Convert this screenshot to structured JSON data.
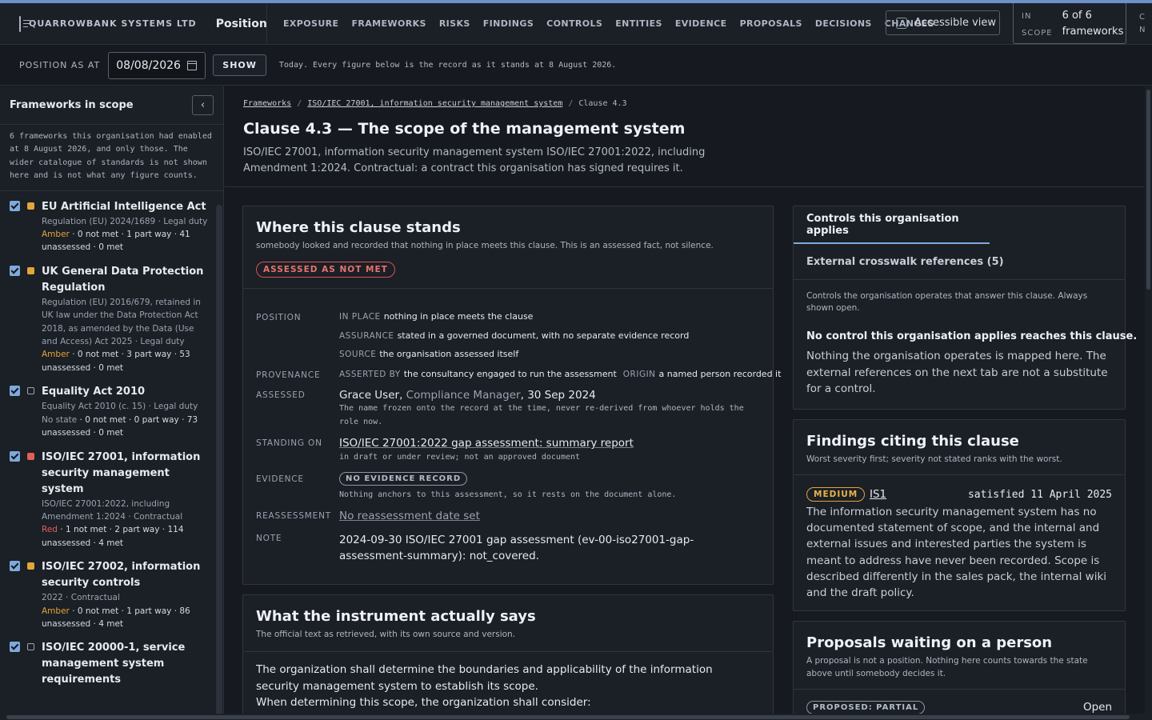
{
  "header": {
    "brand": "QUARROWBANK SYSTEMS LTD",
    "section": "Position",
    "nav": [
      "EXPOSURE",
      "FRAMEWORKS",
      "RISKS",
      "FINDINGS",
      "CONTROLS",
      "ENTITIES",
      "EVIDENCE",
      "PROPOSALS",
      "DECISIONS",
      "CHANGES"
    ],
    "accessible_label": "Accessible view",
    "scope_label_1": "IN",
    "scope_label_2": "SCOPE",
    "scope_value_1": "6 of 6",
    "scope_value_2": "frameworks",
    "cut_1": "C",
    "cut_2": "N"
  },
  "position_bar": {
    "label": "POSITION AS AT",
    "date": "08/08/2026",
    "show_label": "SHOW",
    "note": "Today. Every figure below is the record as it stands at 8 August 2026."
  },
  "sidebar": {
    "title": "Frameworks in scope",
    "collapse_glyph": "‹",
    "description": "6 frameworks this organisation had enabled at 8 August 2026, and only those. The wider catalogue of standards is not shown here and is not what any figure counts.",
    "frameworks": [
      {
        "name": "EU Artificial Intelligence Act",
        "meta": "Regulation (EU) 2024/1689 · Legal duty",
        "state": "Amber",
        "counts": " · 0 not met · 1 part way · 41 unassessed · 0 met",
        "color": "#e0a63a"
      },
      {
        "name": "UK General Data Protection Regulation",
        "meta": "Regulation (EU) 2016/679, retained in UK law under the Data Protection Act 2018, as amended by the Data (Use and Access) Act 2025 · Legal duty",
        "state": "Amber",
        "counts": " · 0 not met · 3 part way · 53 unassessed · 0 met",
        "color": "#e0a63a"
      },
      {
        "name": "Equality Act 2010",
        "meta": "Equality Act 2010 (c. 15) · Legal duty",
        "state": "No state",
        "counts": " · 0 not met · 0 part way · 73 unassessed · 0 met",
        "color": ""
      },
      {
        "name": "ISO/IEC 27001, information security management system",
        "meta": "ISO/IEC 27001:2022, including Amendment 1:2024 · Contractual",
        "state": "Red",
        "counts": " · 1 not met · 2 part way · 114 unassessed · 4 met",
        "color": "#e0605a"
      },
      {
        "name": "ISO/IEC 27002, information security controls",
        "meta": "2022 · Contractual",
        "state": "Amber",
        "counts": " · 0 not met · 1 part way · 86 unassessed · 4 met",
        "color": "#e0a63a"
      },
      {
        "name": "ISO/IEC 20000-1, service management system requirements",
        "meta": "",
        "state": "",
        "counts": "",
        "color": ""
      }
    ]
  },
  "main": {
    "crumbs": [
      "Frameworks",
      "ISO/IEC 27001, information security management system",
      "Clause 4.3"
    ],
    "crumb_sep": "/",
    "title": "Clause 4.3 — The scope of the management system",
    "subtitle": "ISO/IEC 27001, information security management system ISO/IEC 27001:2022, including Amendment 1:2024. Contractual: a contract this organisation has signed requires it."
  },
  "stands": {
    "title": "Where this clause stands",
    "subtitle": "somebody looked and recorded that nothing in place meets this clause. This is an assessed fact, not silence.",
    "badge": "ASSESSED AS NOT MET",
    "position_label": "POSITION",
    "in_place_key": "IN PLACE",
    "in_place_val": "nothing in place meets the clause",
    "assurance_key": "ASSURANCE",
    "assurance_val": "stated in a governed document, with no separate evidence record",
    "source_key": "SOURCE",
    "source_val": "the organisation assessed itself",
    "provenance_label": "PROVENANCE",
    "asserted_key": "ASSERTED BY",
    "asserted_val": "the consultancy engaged to run the assessment",
    "origin_key": "ORIGIN",
    "origin_val": "a named person recorded it",
    "assessed_label": "ASSESSED",
    "assessed_name": "Grace User",
    "assessed_role": "Compliance Manager",
    "assessed_date": ", 30 Sep 2024",
    "assessed_note": "The name frozen onto the record at the time, never re-derived from whoever holds the role now.",
    "standing_label": "STANDING ON",
    "standing_doc": "ISO/IEC 27001:2022 gap assessment: summary report",
    "standing_note": "in draft or under review; not an approved document",
    "evidence_label": "EVIDENCE",
    "evidence_badge": "NO EVIDENCE RECORD",
    "evidence_note": "Nothing anchors to this assessment, so it rests on the document alone.",
    "reassess_label": "REASSESSMENT",
    "reassess_val": "No reassessment date set",
    "note_label": "NOTE",
    "note_val": "2024-09-30 ISO/IEC 27001 gap assessment (ev-00-iso27001-gap-assessment-summary): not_covered."
  },
  "instrument": {
    "title": "What the instrument actually says",
    "subtitle": "The official text as retrieved, with its own source and version.",
    "text_1": "The organization shall determine the boundaries and applicability of the information",
    "text_2": "security management system to establish its scope.",
    "text_3": "When determining this scope, the organization shall consider:"
  },
  "controls": {
    "tab_1": "Controls this organisation applies",
    "tab_2": "External crosswalk references (5)",
    "note": "Controls the organisation operates that answer this clause. Always shown open.",
    "headline": "No control this organisation applies reaches this clause.",
    "body": "Nothing the organisation operates is mapped here. The external references on the next tab are not a substitute for a control."
  },
  "findings": {
    "title": "Findings citing this clause",
    "subtitle": "Worst severity first; severity not stated ranks with the worst.",
    "severity": "MEDIUM",
    "id": "IS1",
    "status": "satisfied 11 April 2025",
    "body": "The information security management system has no documented statement of scope, and the internal and external issues and interested parties the system is meant to address have never been recorded. Scope is described differently in the sales pack, the internal wiki and the draft policy."
  },
  "proposals": {
    "title": "Proposals waiting on a person",
    "subtitle": "A proposal is not a position. Nothing here counts towards the state above until somebody decides it.",
    "badge": "PROPOSED: PARTIAL",
    "status": "Open"
  },
  "colors": {
    "accent": "#7ea9dc",
    "red": "#e0605a",
    "amber": "#e0a63a"
  }
}
